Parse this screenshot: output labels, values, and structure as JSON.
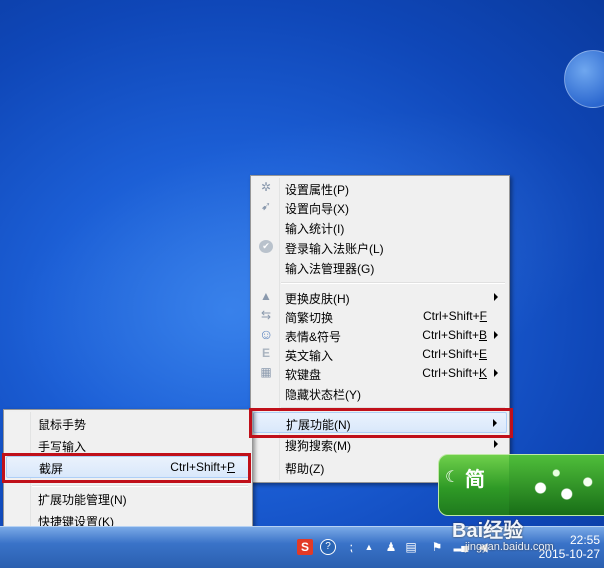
{
  "main_menu": {
    "items": [
      {
        "label": "设置属性(P)",
        "icon": "gear-icon",
        "glyph": "✲"
      },
      {
        "label": "设置向导(X)",
        "icon": "wand-icon",
        "glyph": "➹"
      },
      {
        "label": "输入统计(I)",
        "icon": "",
        "glyph": ""
      },
      {
        "label": "登录输入法账户(L)",
        "icon": "check-circle-icon",
        "glyph": "✔"
      },
      {
        "label": "输入法管理器(G)",
        "icon": "",
        "glyph": ""
      },
      {
        "label": "更换皮肤(H)",
        "icon": "brush-icon",
        "glyph": "▲"
      },
      {
        "label": "简繁切换",
        "icon": "swap-icon",
        "glyph": "⇆",
        "shortcut_prefix": "Ctrl+Shift+",
        "shortcut_key": "F"
      },
      {
        "label": "表情&符号",
        "icon": "smiley-icon",
        "glyph": "☺",
        "shortcut_prefix": "Ctrl+Shift+",
        "shortcut_key": "B"
      },
      {
        "label": "英文输入",
        "icon": "letter-e-icon",
        "glyph": "E",
        "shortcut_prefix": "Ctrl+Shift+",
        "shortcut_key": "E"
      },
      {
        "label": "软键盘",
        "icon": "keyboard-icon",
        "glyph": "▦",
        "shortcut_prefix": "Ctrl+Shift+",
        "shortcut_key": "K"
      },
      {
        "label": "隐藏状态栏(Y)",
        "icon": "",
        "glyph": ""
      },
      {
        "label": "扩展功能(N)",
        "icon": "",
        "glyph": ""
      },
      {
        "label": "搜狗搜索(M)",
        "icon": "",
        "glyph": ""
      },
      {
        "label": "帮助(Z)",
        "icon": "",
        "glyph": ""
      }
    ]
  },
  "sub_menu": {
    "items": [
      {
        "label": "鼠标手势"
      },
      {
        "label": "手写输入"
      },
      {
        "label": "截屏",
        "shortcut_prefix": "Ctrl+Shift+",
        "shortcut_key": "P"
      },
      {
        "label": "扩展功能管理(N)"
      },
      {
        "label": "快捷键设置(K)"
      }
    ]
  },
  "ime_status": {
    "mode_label": "简",
    "moon_glyph": "☾"
  },
  "taskbar": {
    "clock_time": "22:55",
    "clock_date": "2015-10-27",
    "sogou_glyph": "S",
    "help_glyph": "?"
  },
  "watermark": {
    "logo": "Bai经验",
    "url": "jingyan.baidu.com"
  },
  "colors": {
    "highlight_box": "#c0101a",
    "desktop": "#1c5fd6",
    "ime_green": "#2f9a26"
  }
}
